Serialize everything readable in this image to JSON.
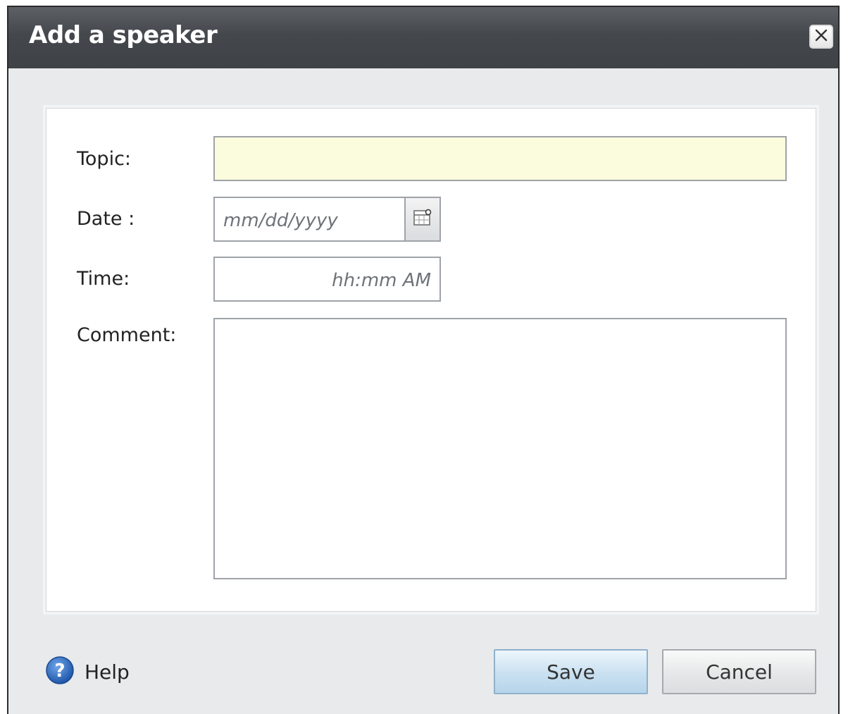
{
  "dialog": {
    "title": "Add a speaker",
    "close_icon": "close-icon"
  },
  "form": {
    "topic": {
      "label": "Topic:",
      "value": "",
      "background": "#fbfbdd"
    },
    "date": {
      "label": "Date :",
      "value": "",
      "placeholder": "mm/dd/yyyy",
      "picker_icon": "calendar-icon"
    },
    "time": {
      "label": "Time:",
      "value": "",
      "placeholder": "hh:mm AM"
    },
    "comment": {
      "label": "Comment:",
      "value": ""
    }
  },
  "footer": {
    "help_label": "Help",
    "help_icon": "help-icon",
    "save_label": "Save",
    "cancel_label": "Cancel"
  },
  "colors": {
    "titlebar": "#44484d",
    "save_button": "#c9e0f1",
    "help_icon": "#2f6fc0"
  }
}
